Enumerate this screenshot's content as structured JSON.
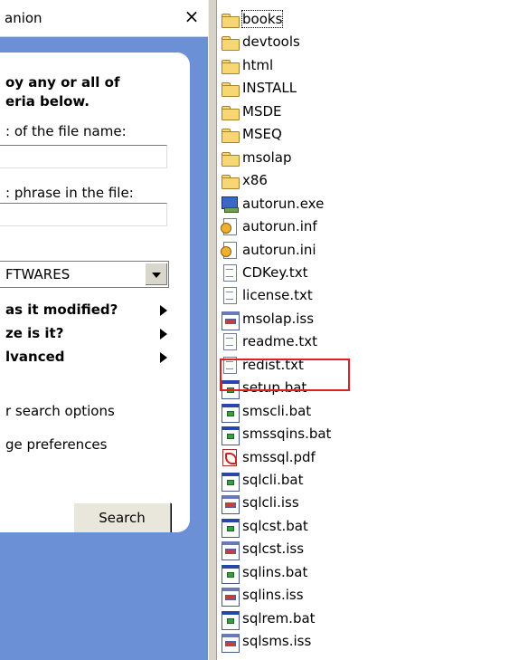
{
  "companion": {
    "title_fragment": "anion",
    "close_glyph": "×",
    "heading_line1": "oy any or all of",
    "heading_line2": "eria below.",
    "filename_label": ": of the file name:",
    "filename_value": "",
    "phrase_label": ": phrase in the file:",
    "phrase_value": "",
    "lookin_value": "FTWARES",
    "options": [
      {
        "label": "as it modified?"
      },
      {
        "label": "ze is it?"
      },
      {
        "label": "lvanced"
      }
    ],
    "links": [
      {
        "label": "r search options"
      },
      {
        "label": "ge preferences"
      }
    ],
    "search_button": "Search"
  },
  "files": [
    {
      "name": "books",
      "type": "folder"
    },
    {
      "name": "devtools",
      "type": "folder"
    },
    {
      "name": "html",
      "type": "folder"
    },
    {
      "name": "INSTALL",
      "type": "folder"
    },
    {
      "name": "MSDE",
      "type": "folder"
    },
    {
      "name": "MSEQ",
      "type": "folder"
    },
    {
      "name": "msolap",
      "type": "folder"
    },
    {
      "name": "x86",
      "type": "folder"
    },
    {
      "name": "autorun.exe",
      "type": "exe"
    },
    {
      "name": "autorun.inf",
      "type": "inf"
    },
    {
      "name": "autorun.ini",
      "type": "inf"
    },
    {
      "name": "CDKey.txt",
      "type": "text"
    },
    {
      "name": "license.txt",
      "type": "text"
    },
    {
      "name": "msolap.iss",
      "type": "iss"
    },
    {
      "name": "readme.txt",
      "type": "text"
    },
    {
      "name": "redist.txt",
      "type": "text"
    },
    {
      "name": "setup.bat",
      "type": "bat"
    },
    {
      "name": "smscli.bat",
      "type": "bat"
    },
    {
      "name": "smssqins.bat",
      "type": "bat"
    },
    {
      "name": "smssql.pdf",
      "type": "pdf"
    },
    {
      "name": "sqlcli.bat",
      "type": "bat"
    },
    {
      "name": "sqlcli.iss",
      "type": "iss"
    },
    {
      "name": "sqlcst.bat",
      "type": "bat"
    },
    {
      "name": "sqlcst.iss",
      "type": "iss"
    },
    {
      "name": "sqlins.bat",
      "type": "bat"
    },
    {
      "name": "sqlins.iss",
      "type": "iss"
    },
    {
      "name": "sqlrem.bat",
      "type": "bat"
    },
    {
      "name": "sqlsms.iss",
      "type": "iss"
    }
  ],
  "colors": {
    "pane_blue": "#6c90d6",
    "highlight_red": "#e0201e"
  }
}
